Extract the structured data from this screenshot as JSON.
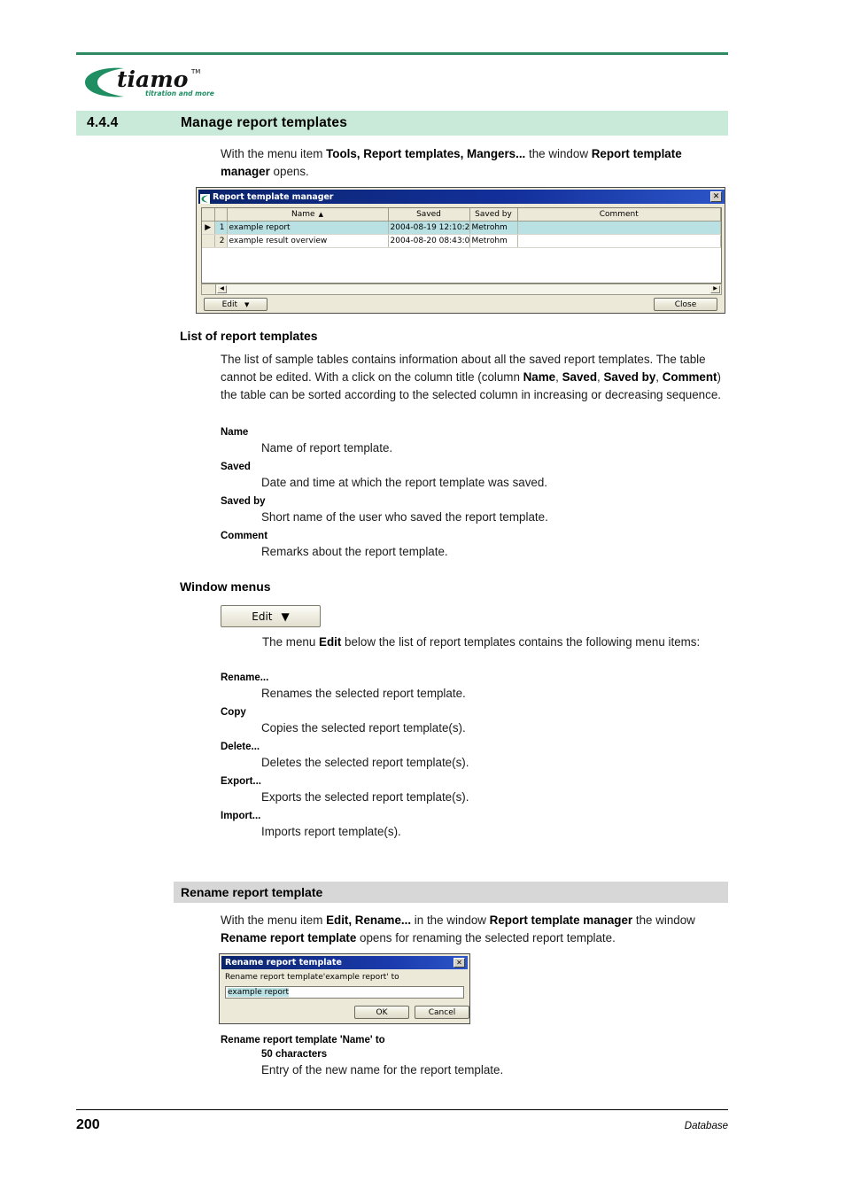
{
  "document": {
    "logo": {
      "wordmark": "tiamo",
      "tm": "TM",
      "tagline": "titration and more"
    },
    "footer": {
      "page_number": "200",
      "chapter": "Database"
    }
  },
  "section": {
    "number": "4.4.4",
    "title": "Manage report templates",
    "intro_prefix": "With the menu item ",
    "intro_menu": "Tools, Report templates, Mangers...",
    "intro_mid": " the window ",
    "intro_window": "Report template manager",
    "intro_suffix": " opens."
  },
  "report_template_manager": {
    "title": "Report template manager",
    "close_icon": "✕",
    "columns": [
      "",
      "",
      "Name",
      "Saved",
      "Saved by",
      "Comment"
    ],
    "sort_column": "Name",
    "sort_caret": "▲",
    "rows": [
      {
        "marker": "▶",
        "index": "1",
        "name": "example report",
        "saved": "2004-08-19 12:10:2...",
        "saved_by": "Metrohm",
        "comment": "",
        "selected": true
      },
      {
        "marker": "",
        "index": "2",
        "name": "example result overview",
        "saved": "2004-08-20 08:43:0...",
        "saved_by": "Metrohm",
        "comment": "",
        "selected": false
      }
    ],
    "scroll_left_arrow": "◀",
    "scroll_right_arrow": "▶",
    "edit_button": "Edit",
    "edit_caret": "▼",
    "close_button": "Close"
  },
  "list_of_report_templates": {
    "heading": "List of report templates",
    "paragraph": {
      "p1": "The list of sample tables contains information about all the saved report templates. The table cannot be edited. With a click on the column title (column ",
      "b1": "Name",
      "p2": ", ",
      "b2": "Saved",
      "p3": ", ",
      "b3": "Saved by",
      "p4": ", ",
      "b4": "Comment",
      "p5": ") the table can be sorted according to the selected column in increasing or decreasing sequence."
    },
    "definitions": [
      {
        "term": "Name",
        "definition": "Name of report template."
      },
      {
        "term": "Saved",
        "definition": "Date and time at which the report template was saved."
      },
      {
        "term": "Saved by",
        "definition": "Short name of the user who saved the report template."
      },
      {
        "term": "Comment",
        "definition": "Remarks about the report template."
      }
    ]
  },
  "window_menus": {
    "heading": "Window menus",
    "edit_button": "Edit",
    "edit_caret": "▼",
    "paragraph": {
      "p1": "The menu ",
      "b1": "Edit",
      "p2": " below the list of report templates contains the following menu items:"
    },
    "menu_items": [
      {
        "term": "Rename...",
        "definition": "Renames the selected report template."
      },
      {
        "term": "Copy",
        "definition": "Copies the selected report template(s)."
      },
      {
        "term": "Delete...",
        "definition": "Deletes the selected report template(s)."
      },
      {
        "term": "Export...",
        "definition": "Exports the selected report template(s)."
      },
      {
        "term": "Import...",
        "definition": "Imports report template(s)."
      }
    ]
  },
  "rename_section": {
    "heading": "Rename report template",
    "paragraph": {
      "p1": "With the menu item ",
      "b1": "Edit, Rename...",
      "p2": " in the window ",
      "b2": "Report template manager",
      "p3": " the window ",
      "b3": "Rename report template",
      "p4": " opens for renaming the selected report template."
    },
    "dialog": {
      "title": "Rename report template",
      "close_icon": "✕",
      "label": "Rename report template'example report' to",
      "input_value": "example report",
      "ok_button": "OK",
      "cancel_button": "Cancel"
    },
    "field_doc": {
      "term": "Rename report template 'Name' to",
      "term2": "50 characters",
      "definition": "Entry of  the new name for the report template."
    }
  },
  "colors": {
    "brand_green": "#2f8a62",
    "section_bar": "#c9ead8",
    "grey_bar": "#d7d7d7",
    "titlebar_blue": "#0a246a",
    "row_selected": "#b9e0e3"
  }
}
